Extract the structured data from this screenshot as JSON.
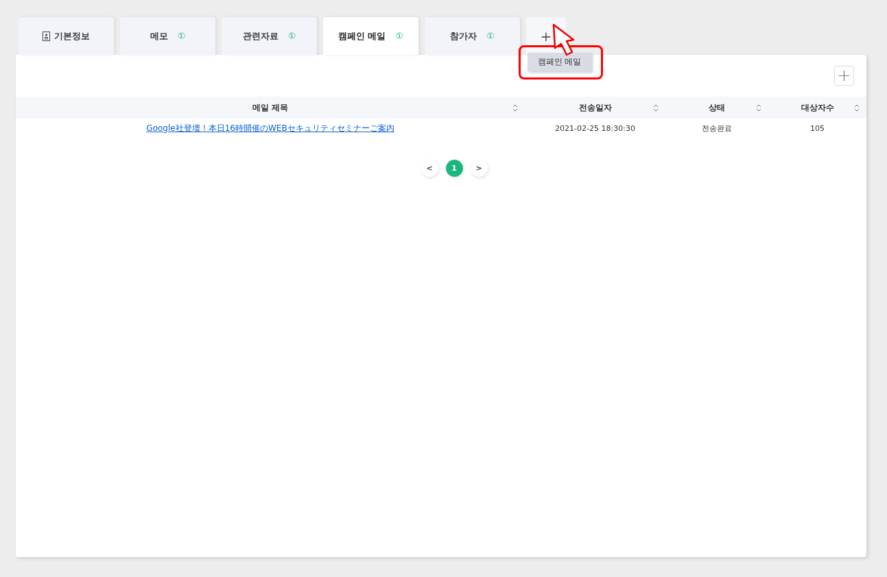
{
  "tabs": [
    {
      "label": "기본정보",
      "icon": true,
      "selected": false
    },
    {
      "label": "메모",
      "badge": "①",
      "icon": false,
      "selected": false
    },
    {
      "label": "관련자료",
      "badge": "①",
      "icon": false,
      "selected": false
    },
    {
      "label": "캠페인 메일",
      "badge": "①",
      "icon": false,
      "selected": true
    },
    {
      "label": "참가자",
      "badge": "①",
      "icon": false,
      "selected": false
    }
  ],
  "add_tab": {
    "label": "+"
  },
  "add_menu": {
    "items": [
      "캠페인 메일"
    ]
  },
  "table": {
    "columns": [
      "메일 제목",
      "전송일자",
      "상태",
      "대상자수"
    ],
    "rows": [
      {
        "title": "Google社登壇！本日16時開催のWEBセキュリティセミナーご案内",
        "sent_at": "2021-02-25 18:30:30",
        "status": "전송완료",
        "recipients": "105"
      }
    ]
  },
  "pagination": {
    "prev": "<",
    "next": ">",
    "pages": [
      {
        "label": "1",
        "selected": true
      }
    ]
  }
}
